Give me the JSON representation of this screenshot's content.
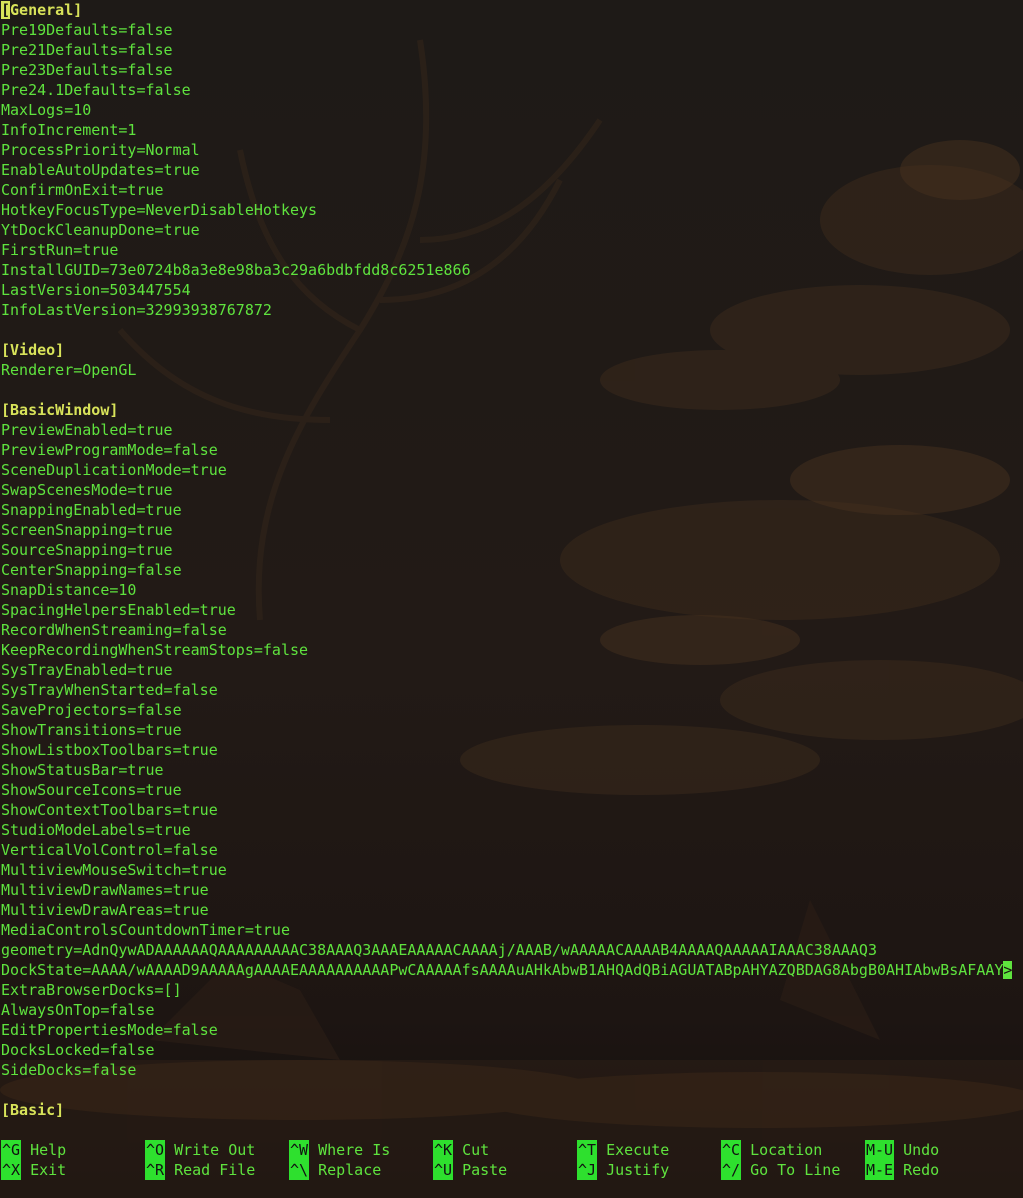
{
  "sections": [
    {
      "header": "[General]",
      "entries": [
        "Pre19Defaults=false",
        "Pre21Defaults=false",
        "Pre23Defaults=false",
        "Pre24.1Defaults=false",
        "MaxLogs=10",
        "InfoIncrement=1",
        "ProcessPriority=Normal",
        "EnableAutoUpdates=true",
        "ConfirmOnExit=true",
        "HotkeyFocusType=NeverDisableHotkeys",
        "YtDockCleanupDone=true",
        "FirstRun=true",
        "InstallGUID=73e0724b8a3e8e98ba3c29a6bdbfdd8c6251e866",
        "LastVersion=503447554",
        "InfoLastVersion=32993938767872"
      ]
    },
    {
      "header": "[Video]",
      "entries": [
        "Renderer=OpenGL"
      ]
    },
    {
      "header": "[BasicWindow]",
      "entries": [
        "PreviewEnabled=true",
        "PreviewProgramMode=false",
        "SceneDuplicationMode=true",
        "SwapScenesMode=true",
        "SnappingEnabled=true",
        "ScreenSnapping=true",
        "SourceSnapping=true",
        "CenterSnapping=false",
        "SnapDistance=10",
        "SpacingHelpersEnabled=true",
        "RecordWhenStreaming=false",
        "KeepRecordingWhenStreamStops=false",
        "SysTrayEnabled=true",
        "SysTrayWhenStarted=false",
        "SaveProjectors=false",
        "ShowTransitions=true",
        "ShowListboxToolbars=true",
        "ShowStatusBar=true",
        "ShowSourceIcons=true",
        "ShowContextToolbars=true",
        "StudioModeLabels=true",
        "VerticalVolControl=false",
        "MultiviewMouseSwitch=true",
        "MultiviewDrawNames=true",
        "MultiviewDrawAreas=true",
        "MediaControlsCountdownTimer=true",
        "geometry=AdnQywADAAAAAAQAAAAAAAAAC38AAAQ3AAAEAAAAACAAAAj/AAAB/wAAAAACAAAAB4AAAAQAAAAAIAAAC38AAAQ3",
        "DockState=AAAA/wAAAAD9AAAAAgAAAAEAAAAAAAAAAPwCAAAAAfsAAAAuAHkAbwB1AHQAdQBiAGUATABpAHYAZQBDAG8AbgB0AHIAbwBsAFAAY",
        "ExtraBrowserDocks=[]",
        "AlwaysOnTop=false",
        "EditPropertiesMode=false",
        "DocksLocked=false",
        "SideDocks=false"
      ]
    },
    {
      "header": "[Basic]",
      "entries": []
    }
  ],
  "overflow_marker": ">",
  "shortcuts": [
    [
      {
        "key": "^G",
        "label": "Help"
      },
      {
        "key": "^O",
        "label": "Write Out"
      },
      {
        "key": "^W",
        "label": "Where Is"
      },
      {
        "key": "^K",
        "label": "Cut"
      },
      {
        "key": "^T",
        "label": "Execute"
      },
      {
        "key": "^C",
        "label": "Location"
      },
      {
        "key": "M-U",
        "label": "Undo"
      }
    ],
    [
      {
        "key": "^X",
        "label": "Exit"
      },
      {
        "key": "^R",
        "label": "Read File"
      },
      {
        "key": "^\\",
        "label": "Replace"
      },
      {
        "key": "^U",
        "label": "Paste"
      },
      {
        "key": "^J",
        "label": "Justify"
      },
      {
        "key": "^/",
        "label": "Go To Line"
      },
      {
        "key": "M-E",
        "label": "Redo"
      }
    ]
  ],
  "colors": {
    "text": "#5fe33e",
    "section": "#d8e35a",
    "key_bg": "#2ee02e",
    "background": "#181512"
  }
}
